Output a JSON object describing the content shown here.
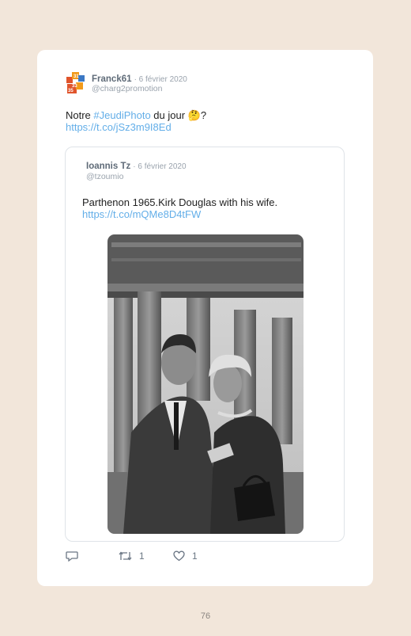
{
  "tweet": {
    "author_name": "Franck61",
    "date": "· 6 février 2020",
    "handle": "@charg2promotion",
    "text_before": "Notre ",
    "hashtag": "#JeudiPhoto",
    "text_after": " du jour 🤔?",
    "link": "https://t.co/jSz3m9I8Ed",
    "avatar_numbers": [
      "31",
      "33",
      "35"
    ]
  },
  "quoted": {
    "author_name": "Ioannis Tz",
    "date": "· 6 février 2020",
    "handle": "@tzoumio",
    "text": "Parthenon 1965.Kirk Douglas with his wife.",
    "link": "https://t.co/mQMe8D4tFW"
  },
  "actions": {
    "retweets": "1",
    "likes": "1"
  },
  "page_number": "76"
}
